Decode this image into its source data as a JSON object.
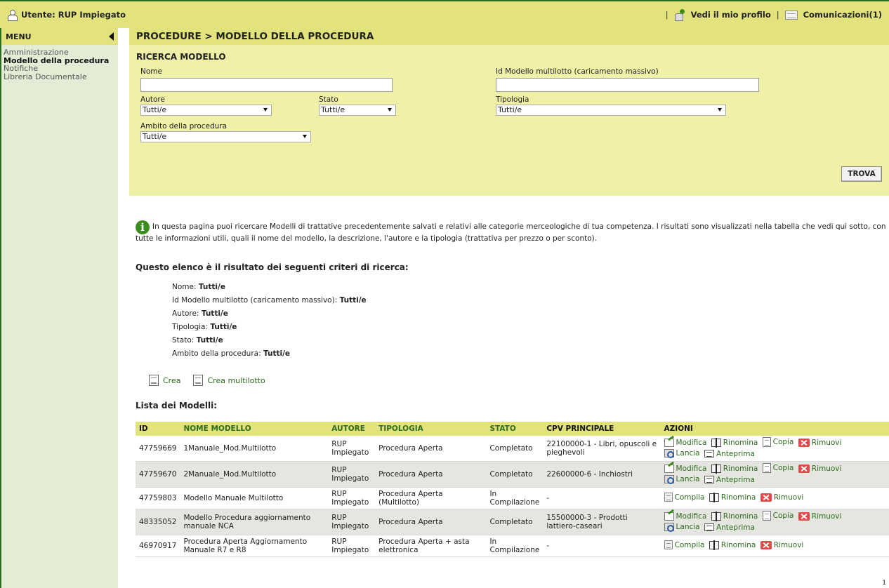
{
  "header": {
    "user_label": "Utente: RUP Impiegato",
    "profile_link": "Vedi il mio profilo",
    "messages_link": "Comunicazioni(1)",
    "separator": "|"
  },
  "sidebar": {
    "title": "MENU",
    "items": [
      {
        "label": "Amministrazione",
        "active": false
      },
      {
        "label": "Modello della procedura",
        "active": true
      },
      {
        "label": "Notifiche",
        "active": false
      },
      {
        "label": "Libreria Documentale",
        "active": false
      }
    ]
  },
  "breadcrumb": "PROCEDURE  > MODELLO DELLA PROCEDURA",
  "search": {
    "title": "RICERCA MODELLO",
    "nome_label": "Nome",
    "nome_value": "",
    "id_label": "Id Modello multilotto (caricamento massivo)",
    "id_value": "",
    "autore_label": "Autore",
    "autore_value": "Tutti/e",
    "stato_label": "Stato",
    "stato_value": "Tutti/e",
    "tipologia_label": "Tipologia",
    "tipologia_value": "Tutti/e",
    "ambito_label": "Ambito della procedura",
    "ambito_value": "Tutti/e",
    "find_button": "TROVA"
  },
  "info_text": "In questa pagina puoi ricercare Modelli di trattative precedentemente salvati e relativi alle categorie merceologiche di tua competenza. I risultati sono visualizzati nella tabella che vedi qui sotto, con tutte le informazioni utili, quali il nome del modello, la descrizione, l'autore e la tipologia (trattativa per prezzo o per sconto).",
  "criteria": {
    "title": "Questo elenco è il risultato dei seguenti criteri di ricerca:",
    "rows": [
      {
        "label": "Nome:",
        "value": "Tutti/e"
      },
      {
        "label": "Id Modello multilotto (caricamento massivo):",
        "value": "Tutti/e"
      },
      {
        "label": "Autore:",
        "value": "Tutti/e"
      },
      {
        "label": "Tipologia:",
        "value": "Tutti/e"
      },
      {
        "label": "Stato:",
        "value": "Tutti/e"
      },
      {
        "label": "Ambito della procedura:",
        "value": "Tutti/e"
      }
    ]
  },
  "create": {
    "crea": "Crea",
    "crea_multi": "Crea multilotto"
  },
  "list_title": "Lista dei Modelli:",
  "table": {
    "headers": [
      "ID",
      "NOME MODELLO",
      "AUTORE",
      "TIPOLOGIA",
      "STATO",
      "CPV PRINCIPALE",
      "AZIONI"
    ],
    "rows": [
      {
        "id": "47759669",
        "nome": "1Manuale_Mod.Multilotto",
        "autore": "RUP Impiegato",
        "tipologia": "Procedura Aperta",
        "stato": "Completato",
        "cpv": "22100000-1 - Libri, opuscoli e pieghevoli"
      },
      {
        "id": "47759670",
        "nome": "2Manuale_Mod.Multilotto",
        "autore": "RUP Impiegato",
        "tipologia": "Procedura Aperta",
        "stato": "Completato",
        "cpv": "22600000-6 - Inchiostri"
      },
      {
        "id": "47759803",
        "nome": "Modello Manuale Multilotto",
        "autore": "RUP Impiegato",
        "tipologia": "Procedura Aperta  (Multilotto)",
        "stato": "In Compilazione",
        "cpv": "-"
      },
      {
        "id": "48335052",
        "nome": "Modello Procedura aggiornamento manuale NCA",
        "autore": "RUP Impiegato",
        "tipologia": "Procedura Aperta",
        "stato": "Completato",
        "cpv": "15500000-3 - Prodotti lattiero-caseari"
      },
      {
        "id": "46970917",
        "nome": "Procedura Aperta Aggiornamento Manuale R7 e R8",
        "autore": "RUP Impiegato",
        "tipologia": "Procedura Aperta  + asta elettronica",
        "stato": "In Compilazione",
        "cpv": "-"
      }
    ]
  },
  "actions": {
    "modifica": "Modifica",
    "rinomina": "Rinomina",
    "copia": "Copia",
    "rimuovi": "Rimuovi",
    "lancia": "Lancia",
    "anteprima": "Anteprima",
    "compila": "Compila"
  },
  "footer_page": "1"
}
